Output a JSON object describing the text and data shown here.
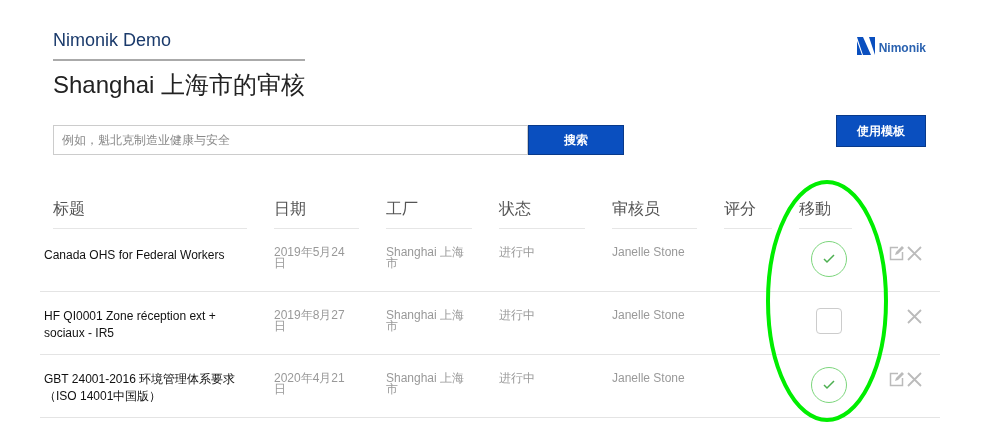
{
  "header": {
    "org": "Nimonik Demo",
    "title": "Shanghai 上海市的审核",
    "logo_text": "Nimonik"
  },
  "search": {
    "placeholder": "例如，魁北克制造业健康与安全",
    "button": "搜索"
  },
  "template_button": "使用模板",
  "table": {
    "columns": [
      "标题",
      "日期",
      "工厂",
      "状态",
      "审核员",
      "评分",
      "移動"
    ],
    "rows": [
      {
        "title": "Canada OHS for Federal Workers",
        "date": "2019年5月24日",
        "factory": "Shanghai 上海市",
        "status": "进行中",
        "auditor": "Janelle Stone",
        "mobile": true,
        "editable": true
      },
      {
        "title": "HF QI0001 Zone réception ext + sociaux - IR5",
        "date": "2019年8月27日",
        "factory": "Shanghai 上海市",
        "status": "进行中",
        "auditor": "Janelle Stone",
        "mobile": false,
        "editable": false
      },
      {
        "title": "GBT 24001-2016 环境管理体系要求（ISO 14001中国版）",
        "date": "2020年4月21日",
        "factory": "Shanghai 上海市",
        "status": "进行中",
        "auditor": "Janelle Stone",
        "mobile": true,
        "editable": true
      }
    ]
  },
  "annotations": [
    {
      "kind": "ellipse",
      "color": "#00ee00"
    }
  ]
}
